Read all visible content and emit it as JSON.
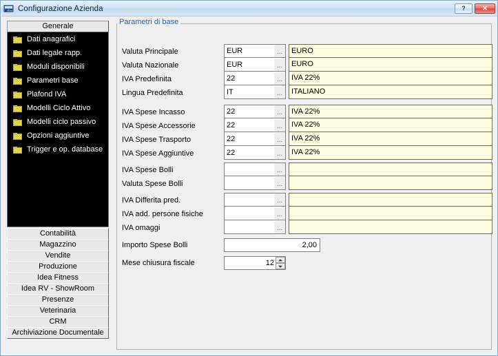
{
  "window": {
    "title": "Configurazione Azienda",
    "icon": "company-config-icon",
    "help_label": "?",
    "close_label": "✕"
  },
  "sidebar": {
    "header": "Generale",
    "tree_items": [
      {
        "label": "Dati anagrafici",
        "icon": "folder-icon"
      },
      {
        "label": "Dati legale rapp.",
        "icon": "folder-icon"
      },
      {
        "label": "Moduli disponibili",
        "icon": "folder-icon"
      },
      {
        "label": "Parametri base",
        "icon": "folder-icon"
      },
      {
        "label": "Plafond IVA",
        "icon": "folder-icon"
      },
      {
        "label": "Modelli Ciclo Attivo",
        "icon": "folder-icon"
      },
      {
        "label": "Modelli ciclo passivo",
        "icon": "folder-icon"
      },
      {
        "label": "Opzioni aggiuntive",
        "icon": "folder-icon"
      },
      {
        "label": "Trigger e op. database",
        "icon": "folder-icon"
      }
    ],
    "tabs": [
      {
        "label": "Contabilità"
      },
      {
        "label": "Magazzino"
      },
      {
        "label": "Vendite"
      },
      {
        "label": "Produzione"
      },
      {
        "label": "Idea Fitness"
      },
      {
        "label": "Idea RV - ShowRoom"
      },
      {
        "label": "Presenze"
      },
      {
        "label": "Veterinaria"
      },
      {
        "label": "CRM"
      },
      {
        "label": "Archiviazione Documentale"
      }
    ]
  },
  "main": {
    "groupbox_legend": "Parametri di base",
    "browse_label": "...",
    "group1": [
      {
        "label": "Valuta Principale",
        "code": "EUR",
        "desc": "EURO"
      },
      {
        "label": "Valuta Nazionale",
        "code": "EUR",
        "desc": "EURO"
      },
      {
        "label": "IVA Predefinita",
        "code": "22",
        "desc": "IVA 22%"
      },
      {
        "label": "Lingua Predefinita",
        "code": "IT",
        "desc": "ITALIANO"
      }
    ],
    "group2": [
      {
        "label": "IVA Spese Incasso",
        "code": "22",
        "desc": "IVA 22%"
      },
      {
        "label": "IVA Spese Accessorie",
        "code": "22",
        "desc": "IVA 22%"
      },
      {
        "label": "IVA Spese Trasporto",
        "code": "22",
        "desc": "IVA 22%"
      },
      {
        "label": "IVA Spese Aggiuntive",
        "code": "22",
        "desc": "IVA 22%"
      }
    ],
    "group3": [
      {
        "label": "IVA Spese Bolli",
        "code": "",
        "desc": ""
      },
      {
        "label": "Valuta Spese Bolli",
        "code": "",
        "desc": ""
      }
    ],
    "group4": [
      {
        "label": "IVA Differita pred.",
        "code": "",
        "desc": ""
      },
      {
        "label": "IVA add. persone fisiche",
        "code": "",
        "desc": ""
      },
      {
        "label": "IVA omaggi",
        "code": "",
        "desc": ""
      }
    ],
    "importo_spese_bolli": {
      "label": "Importo Spese Bolli",
      "value": "2,00"
    },
    "mese_chiusura_fiscale": {
      "label": "Mese chiusura fiscale",
      "value": "12"
    }
  }
}
